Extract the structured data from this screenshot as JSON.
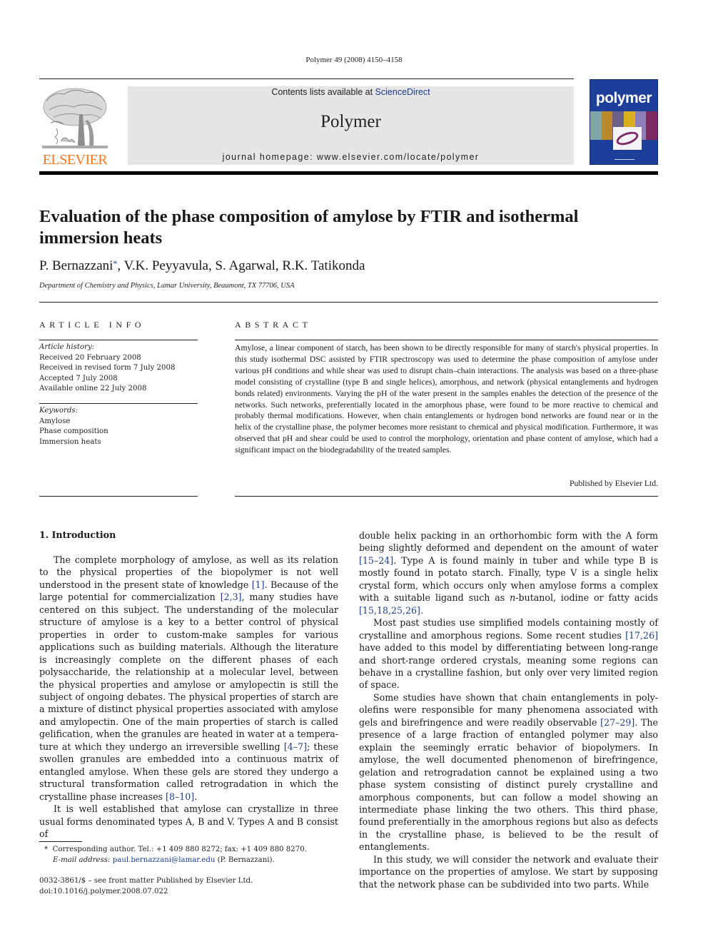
{
  "header": {
    "citation": "Polymer 49 (2008) 4150–4158",
    "contents_prefix": "Contents lists available at ",
    "contents_link": "ScienceDirect",
    "journal_name": "Polymer",
    "homepage": "journal homepage: www.elsevier.com/locate/polymer",
    "publisher_logo_text": "ELSEVIER",
    "cover_title": "polymer"
  },
  "colors": {
    "link": "#1b3d8f",
    "elsevier_orange": "#f47920",
    "masthead_bg": "#e6e6e6",
    "cover_blue": "#1d3f9a"
  },
  "article": {
    "title": "Evaluation of the phase composition of amylose by FTIR and isothermal immersion heats",
    "authors": [
      {
        "name": "P. Bernazzani",
        "corresponding": "*"
      },
      {
        "name": "V.K. Peyyavula"
      },
      {
        "name": "S. Agarwal"
      },
      {
        "name": "R.K. Tatikonda"
      }
    ],
    "affiliation": "Department of Chemistry and Physics, Lamar University, Beaumont, TX 77706, USA"
  },
  "article_info": {
    "heading": "ARTICLE INFO",
    "history_label": "Article history:",
    "history": [
      "Received 20 February 2008",
      "Received in revised form 7 July 2008",
      "Accepted 7 July 2008",
      "Available online 22 July 2008"
    ],
    "keywords_label": "Keywords:",
    "keywords": [
      "Amylose",
      "Phase composition",
      "Immersion heats"
    ]
  },
  "abstract": {
    "heading": "ABSTRACT",
    "text": "Amylose, a linear component of starch, has been shown to be directly responsible for many of starch's physical properties. In this study isothermal DSC assisted by FTIR spectroscopy was used to determine the phase composition of amylose under various pH conditions and while shear was used to disrupt chain–chain interactions. The analysis was based on a three-phase model consisting of crystalline (type B and single helices), amorphous, and network (physical entanglements and hydrogen bonds related) environments. Varying the pH of the water present in the samples enables the detection of the presence of the networks. Such networks, preferentially located in the amorphous phase, were found to be more reactive to chemical and probably thermal modifications. However, when chain entanglements or hydrogen bond networks are found near or in the helix of the crystalline phase, the polymer becomes more resistant to chemical and physical modification. Furthermore, it was observed that pH and shear could be used to control the morphology, orientation and phase content of amylose, which had a significant impact on the biodegradability of the treated samples.",
    "published_by": "Published by Elsevier Ltd."
  },
  "introduction": {
    "heading": "1.  Introduction",
    "left_paragraphs": [
      {
        "segments": [
          {
            "t": "The complete morphology of amylose, as well as its relation to the physical properties of the biopolymer is not well understood in the present state of knowledge "
          },
          {
            "ref": "[1]"
          },
          {
            "t": ". Because of the large potential for commercialization "
          },
          {
            "ref": "[2,3]"
          },
          {
            "t": ", many studies have centered on this subject. The understanding of the molecular structure of amylose is a key to a better control of physical properties in order to custom-make samples for various applications such as building materials. Although the literature is increasingly complete on the different phases of each polysaccharide, the relationship at a molecular level, between the physical properties and amylose or amylopectin is still the subject of ongoing debates. The physical properties of starch are a mixture of distinct physical properties associated with amylose and amylopectin. One of the main properties of starch is called gelification, when the granules are heated in water at a tempera­ture at which they undergo an irreversible swelling "
          },
          {
            "ref": "[4–7]"
          },
          {
            "t": "; these swollen granules are embedded into a continuous matrix of entangled amylose. When these gels are stored they undergo a structural transformation called retrogradation in which the crystalline phase increases "
          },
          {
            "ref": "[8–10]"
          },
          {
            "t": "."
          }
        ]
      },
      {
        "segments": [
          {
            "t": "It is well established that amylose can crystallize in three usual forms denominated types A, B and V. Types A and B consist of"
          }
        ]
      }
    ],
    "right_paragraphs": [
      {
        "noindent": true,
        "segments": [
          {
            "t": "double helix packing in an orthorhombic form with the A form being slightly deformed and dependent on the amount of water "
          },
          {
            "ref": "[15–24]"
          },
          {
            "t": ". Type A is found mainly in tuber and while type B is mostly found in potato starch. Finally, type V is a single helix crystal form, which occurs only when amylose forms a complex with a suitable ligand such as "
          },
          {
            "i": "n"
          },
          {
            "t": "-butanol, iodine or fatty acids "
          },
          {
            "ref": "[15,18,25,26]"
          },
          {
            "t": "."
          }
        ]
      },
      {
        "segments": [
          {
            "t": "Most past studies use simplified models containing mostly of crystalline and amorphous regions. Some recent studies "
          },
          {
            "ref": "[17,26]"
          },
          {
            "t": " have added to this model by differentiating between long-range and short-range ordered crystals, meaning some regions can behave in a crystalline fashion, but only over very limited region of space."
          }
        ]
      },
      {
        "segments": [
          {
            "t": "Some studies have shown that chain entanglements in poly­olefins were responsible for many phenomena associated with gels and birefringence and were readily observable "
          },
          {
            "ref": "[27–29]"
          },
          {
            "t": ". The pres­ence of a large fraction of entangled polymer may also explain the seemingly erratic behavior of biopolymers. In amylose, the well documented phenomenon of birefringence, gelation and retrogra­dation cannot be explained using a two phase system consisting of distinct purely crystalline and amorphous components, but can follow a model showing an intermediate phase linking the two others. This third phase, found preferentially in the amorphous regions but also as defects in the crystalline phase, is believed to be the result of entanglements."
          }
        ]
      },
      {
        "segments": [
          {
            "t": "In this study, we will consider the network and evaluate their importance on the properties of amylose. We start by supposing that the network phase can be subdivided into two parts. While"
          }
        ]
      }
    ]
  },
  "footnote": {
    "marker": "*",
    "corresponding": "Corresponding author. Tel.: +1 409 880 8272; fax: +1 409 880 8270.",
    "email_label": "E-mail address:",
    "email": "paul.bernazzani@lamar.edu",
    "email_suffix": " (P. Bernazzani)."
  },
  "front_matter": {
    "issn_line": "0032-3861/$ – see front matter Published by Elsevier Ltd.",
    "doi": "doi:10.1016/j.polymer.2008.07.022"
  }
}
